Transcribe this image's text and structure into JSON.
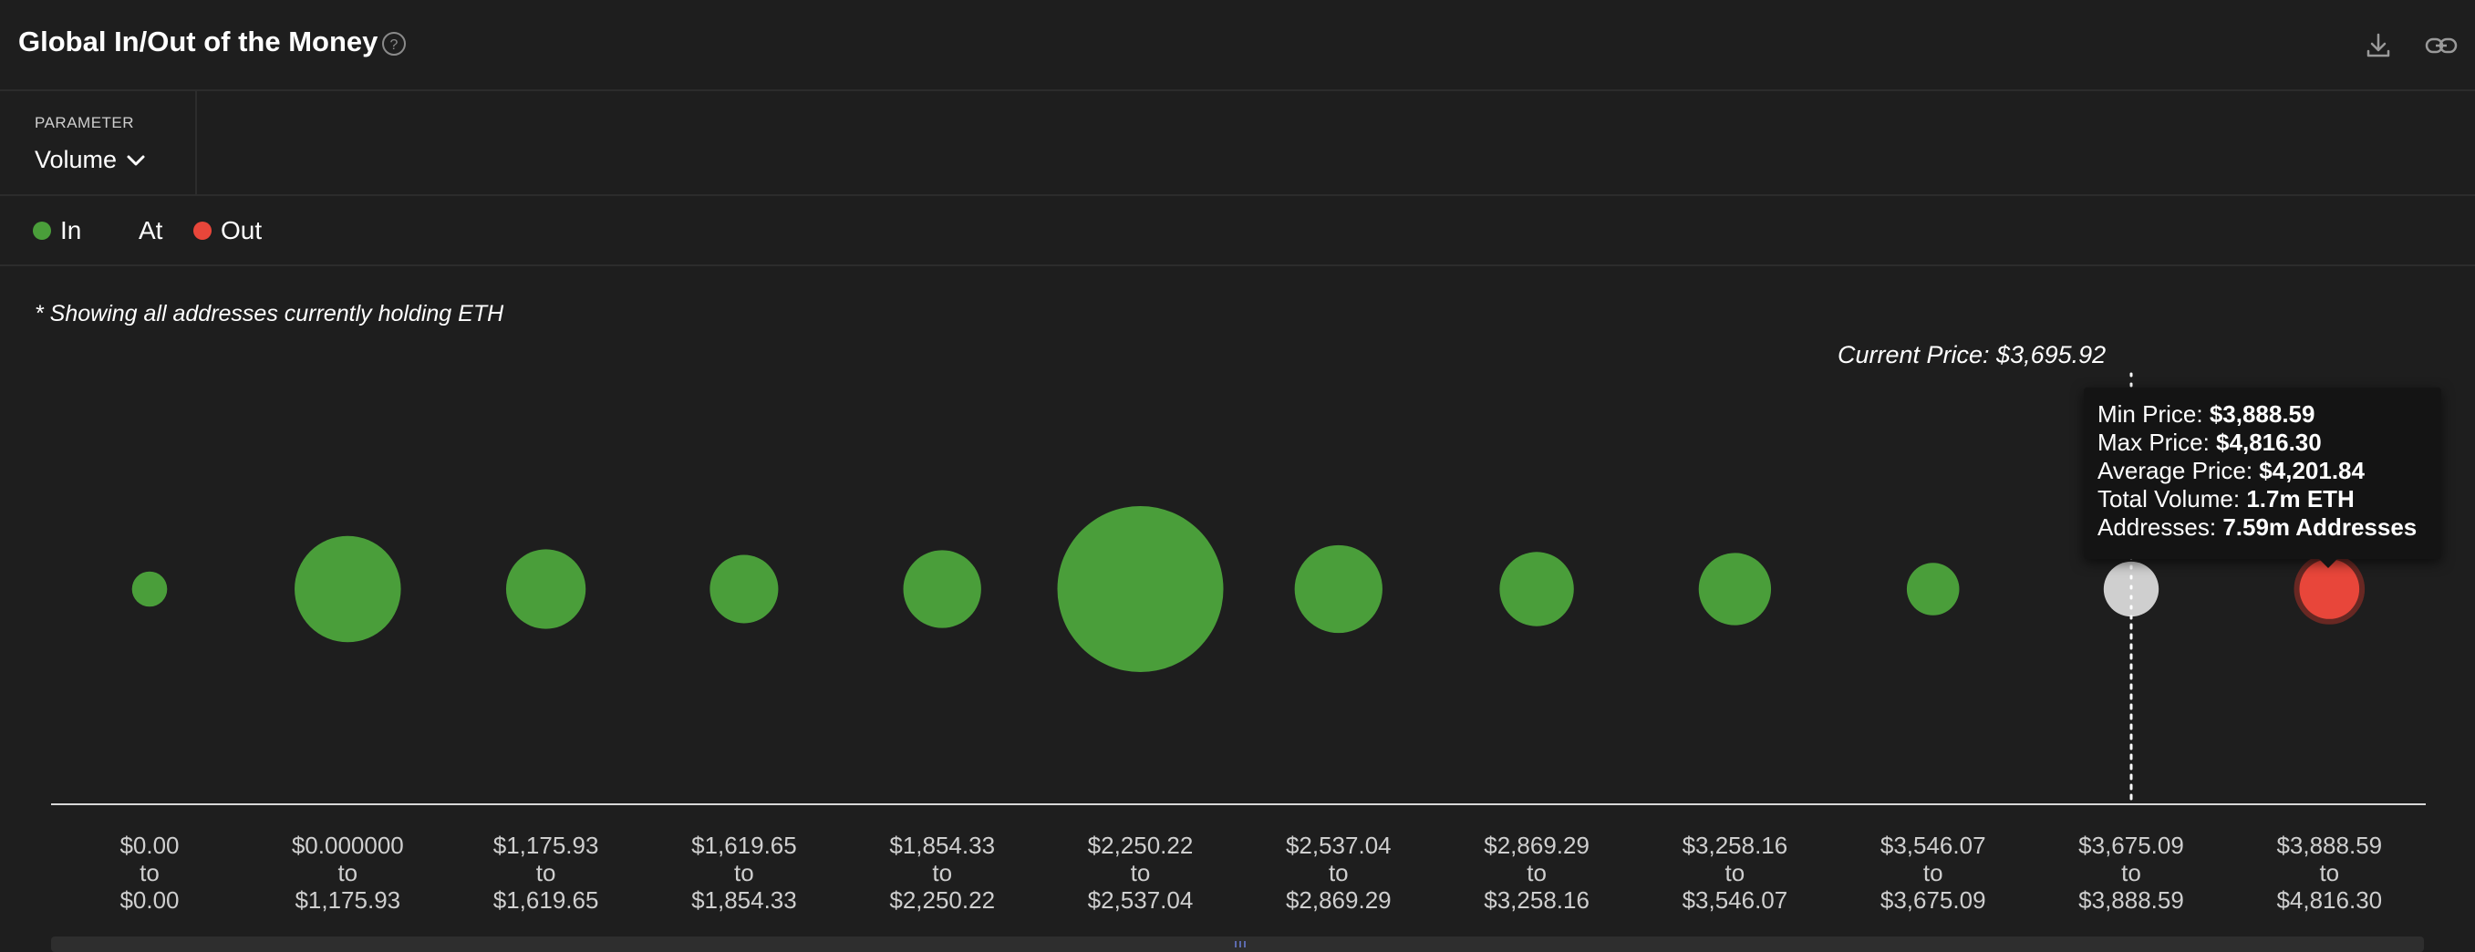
{
  "header": {
    "title": "Global In/Out of the Money",
    "icons": [
      "help-icon",
      "download-icon",
      "link-icon"
    ]
  },
  "parameter": {
    "label": "PARAMETER",
    "value": "Volume"
  },
  "legend": {
    "items": [
      {
        "label": "In",
        "color": "#4a9e3a"
      },
      {
        "label": "At",
        "color": "#cfcfcf"
      },
      {
        "label": "Out",
        "color": "#e8463a"
      }
    ]
  },
  "note": "* Showing all addresses currently holding ETH",
  "current_price_label": "Current Price: $3,695.92",
  "tooltip": {
    "min_price_label": "Min Price:",
    "min_price": "$3,888.59",
    "max_price_label": "Max Price:",
    "max_price": "$4,816.30",
    "avg_price_label": "Average Price:",
    "avg_price": "$4,201.84",
    "volume_label": "Total Volume:",
    "volume": "1.7m ETH",
    "addresses_label": "Addresses:",
    "addresses": "7.59m Addresses"
  },
  "chart_data": {
    "type": "scatter",
    "title": "Global In/Out of the Money",
    "colors": {
      "in": "#4a9e3a",
      "at": "#cfcfcf",
      "out": "#e8463a"
    },
    "current_price": 3695.92,
    "buckets": [
      {
        "from": "$0.00",
        "to": "$0.00",
        "status": "in",
        "relative_size": 0.045
      },
      {
        "from": "$0.000000",
        "to": "$1,175.93",
        "status": "in",
        "relative_size": 0.41
      },
      {
        "from": "$1,175.93",
        "to": "$1,619.65",
        "status": "in",
        "relative_size": 0.23
      },
      {
        "from": "$1,619.65",
        "to": "$1,854.33",
        "status": "in",
        "relative_size": 0.17
      },
      {
        "from": "$1,854.33",
        "to": "$2,250.22",
        "status": "in",
        "relative_size": 0.22
      },
      {
        "from": "$2,250.22",
        "to": "$2,537.04",
        "status": "in",
        "relative_size": 1.0
      },
      {
        "from": "$2,537.04",
        "to": "$2,869.29",
        "status": "in",
        "relative_size": 0.28
      },
      {
        "from": "$2,869.29",
        "to": "$3,258.16",
        "status": "in",
        "relative_size": 0.2
      },
      {
        "from": "$3,258.16",
        "to": "$3,546.07",
        "status": "in",
        "relative_size": 0.19
      },
      {
        "from": "$3,546.07",
        "to": "$3,675.09",
        "status": "in",
        "relative_size": 0.1
      },
      {
        "from": "$3,675.09",
        "to": "$3,888.59",
        "status": "at",
        "relative_size": 0.11
      },
      {
        "from": "$3,888.59",
        "to": "$4,816.30",
        "status": "out",
        "relative_size": 0.13,
        "volume": "1.7m ETH",
        "addresses": "7.59m Addresses",
        "average_price": "$4,201.84"
      }
    ],
    "to_word": "to",
    "legend_placement": "top-left",
    "grid": false
  }
}
